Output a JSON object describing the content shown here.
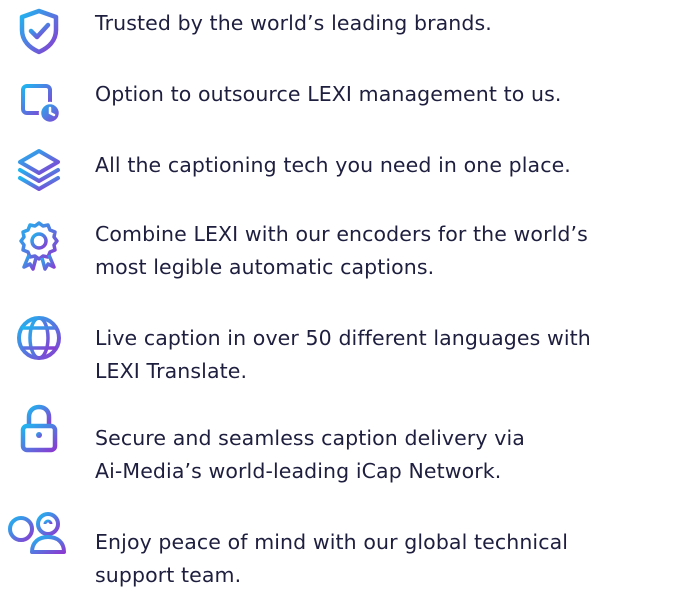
{
  "features": [
    {
      "icon": "shield-check-icon",
      "lines": [
        "Trusted by the world’s leading brands."
      ]
    },
    {
      "icon": "calendar-clock-icon",
      "lines": [
        "Option to outsource LEXI management to us."
      ]
    },
    {
      "icon": "layers-icon",
      "lines": [
        "All the captioning tech you need in one place."
      ]
    },
    {
      "icon": "award-ribbon-icon",
      "lines": [
        "Combine LEXI with our encoders for the world’s",
        "most legible automatic captions."
      ]
    },
    {
      "icon": "globe-icon",
      "lines": [
        "Live caption in over 50 different languages with",
        "LEXI Translate."
      ]
    },
    {
      "icon": "lock-icon",
      "lines": [
        "Secure and seamless caption delivery via",
        "Ai-Media’s world-leading iCap Network."
      ]
    },
    {
      "icon": "support-team-icon",
      "lines": [
        "Enjoy peace of mind with our global technical",
        "support team."
      ]
    }
  ],
  "colors": {
    "gradient_start": "#1fb6f0",
    "gradient_end": "#8a3bd1",
    "text": "#1e1e3f"
  }
}
